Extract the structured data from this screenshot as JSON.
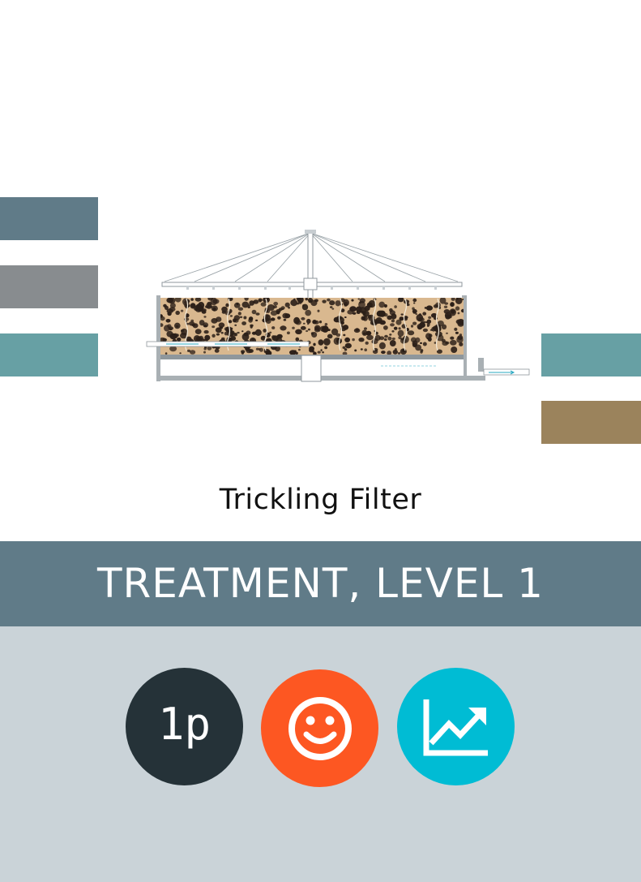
{
  "card": {
    "title": "Trickling Filter",
    "category": "TREATMENT, LEVEL 1"
  },
  "badges": {
    "players": "1p",
    "mood_icon": "smiley-face-icon",
    "growth_icon": "trending-up-chart-icon"
  },
  "colors": {
    "slate": "#607b88",
    "gray": "#888c8f",
    "teal": "#67a0a4",
    "bronze": "#9b835c",
    "footer": "#cad3d8",
    "players_circle": "#253238",
    "mood_circle": "#fd5722",
    "growth_circle": "#00bcd4"
  }
}
